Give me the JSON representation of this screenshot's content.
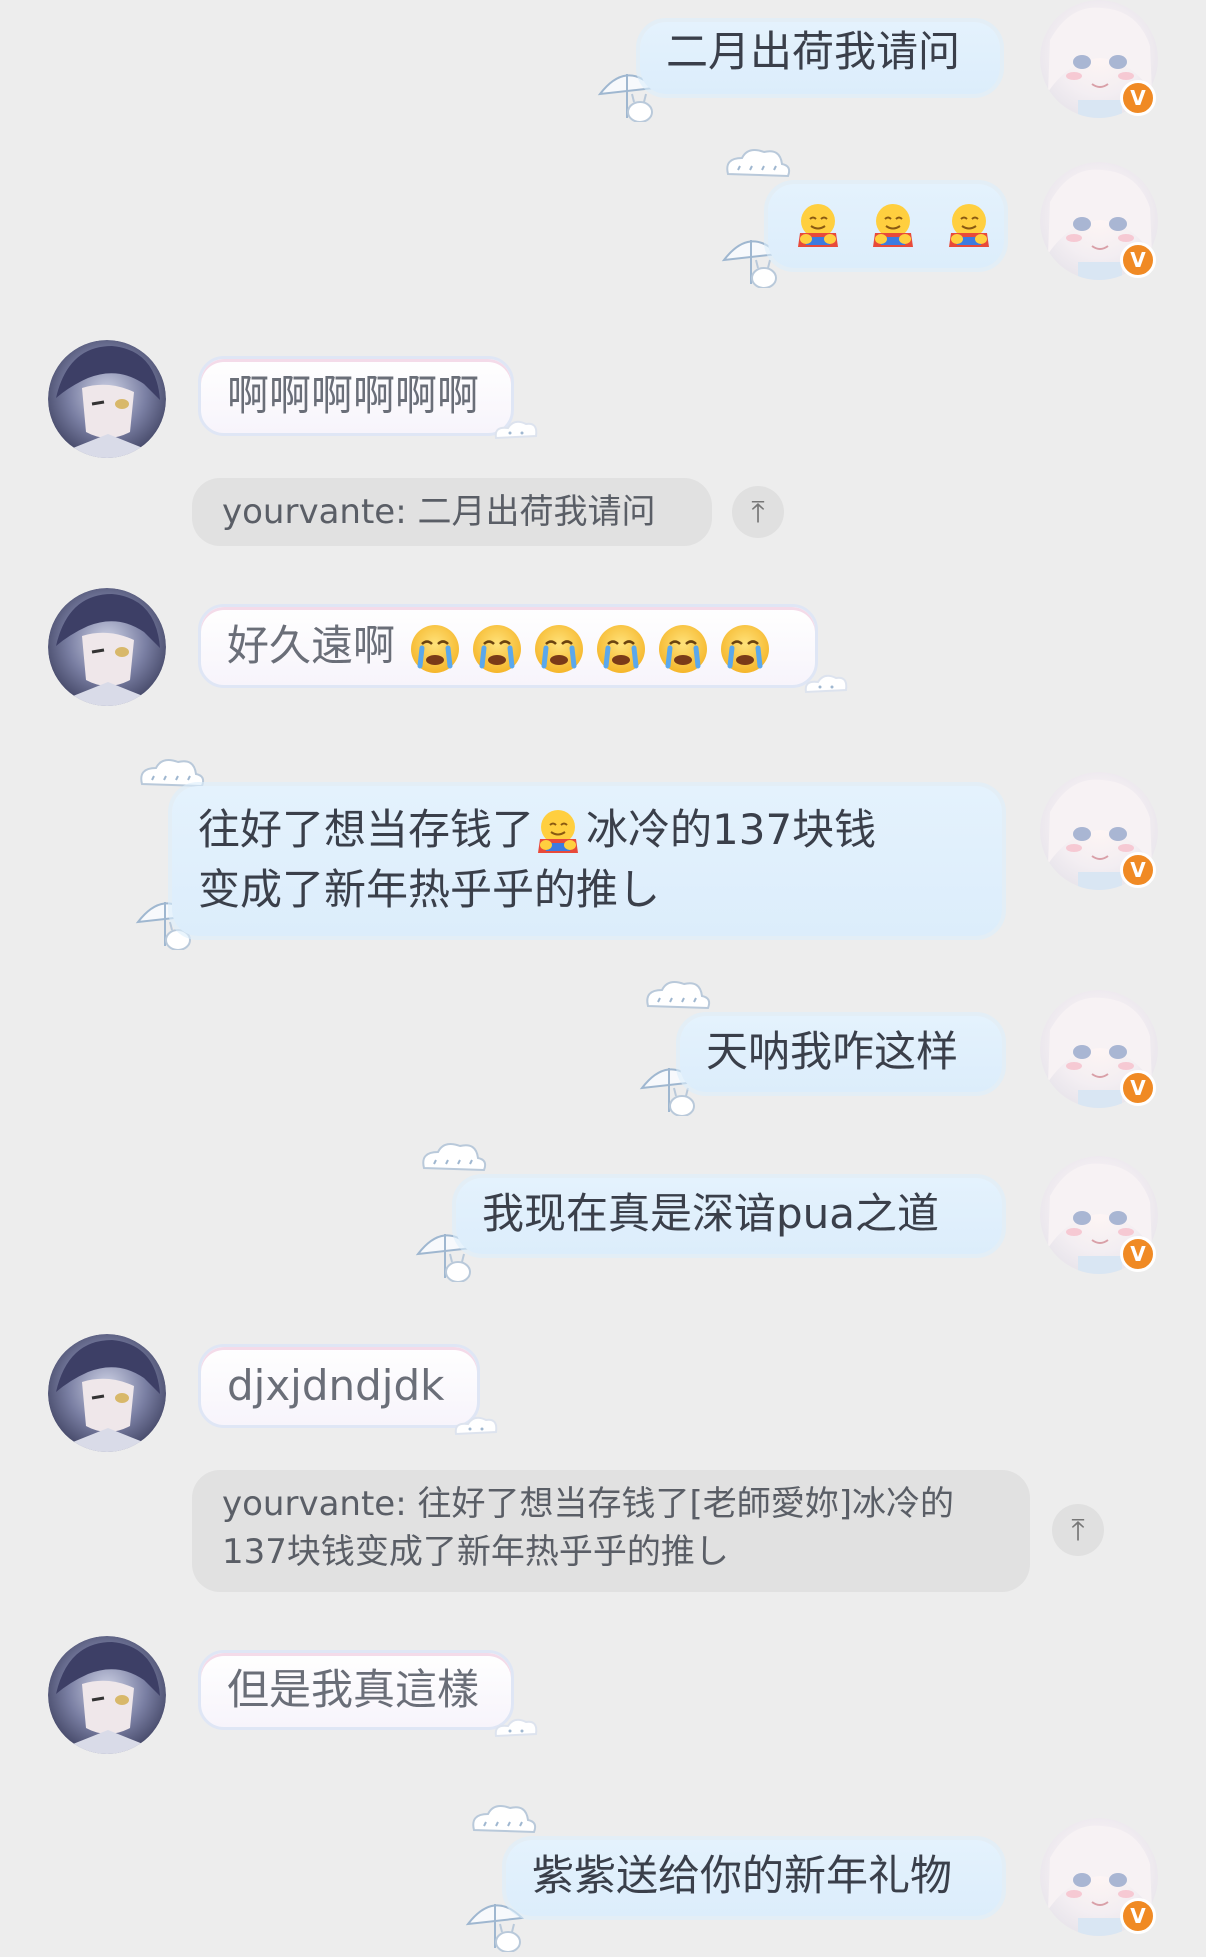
{
  "colors": {
    "background": "#ededed",
    "me_bubble": "#dcedfb",
    "them_bubble": "#ffffff",
    "quote_bg": "#e1e1e1",
    "badge": "#f08a24"
  },
  "icons": {
    "verified": "verified-badge-icon",
    "quote_jump": "jump-to-quote-icon",
    "hug_emoji": "hugging-face-emoji",
    "cry_emoji": "crying-face-emoji"
  },
  "messages": [
    {
      "side": "me",
      "text": "二月出荷我请问"
    },
    {
      "side": "me",
      "text": "",
      "emoji_count": 3
    },
    {
      "side": "them",
      "text": "啊啊啊啊啊啊"
    },
    {
      "side": "quote",
      "text": "yourvante: 二月出荷我请问"
    },
    {
      "side": "them",
      "text": "好久遠啊"
    },
    {
      "side": "me",
      "line1_a": "往好了想当存钱了",
      "line1_b": "冰冷的137块钱",
      "line2": "变成了新年热乎乎的推し"
    },
    {
      "side": "me",
      "text": "天呐我咋这样"
    },
    {
      "side": "me",
      "text": "我现在真是深谙pua之道"
    },
    {
      "side": "them",
      "text": "djxjdndjdk"
    },
    {
      "side": "quote",
      "text": "yourvante: 往好了想当存钱了[老師愛妳]冰冷的137块钱变成了新年热乎乎的推し"
    },
    {
      "side": "them",
      "text": "但是我真這樣"
    },
    {
      "side": "me",
      "text": "紫紫送给你的新年礼物"
    }
  ],
  "badge_letter": "V",
  "quote_arrow": "⤒"
}
